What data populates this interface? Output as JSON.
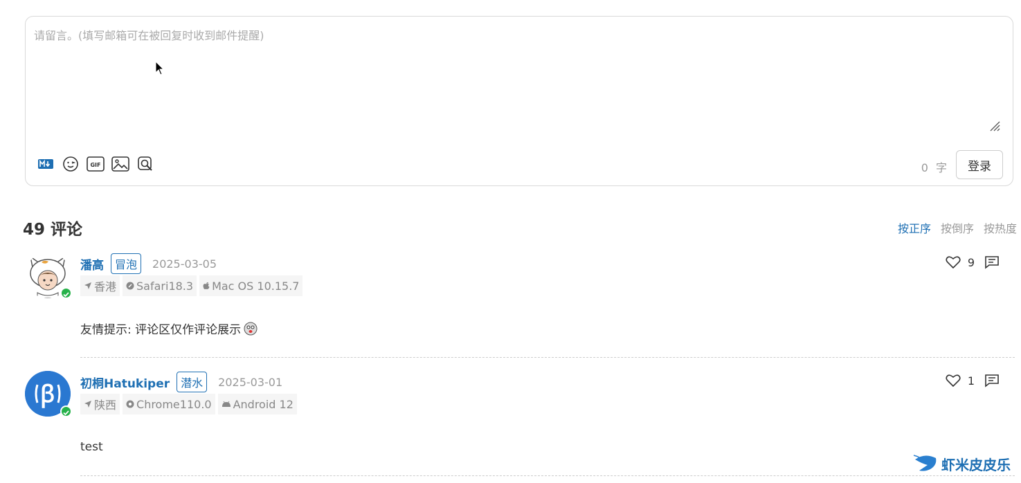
{
  "editor": {
    "placeholder": "请留言。(填写邮箱可在被回复时收到邮件提醒)",
    "tools": [
      "markdown-icon",
      "emoji-icon",
      "gif-icon",
      "image-icon",
      "preview-icon"
    ],
    "word_count": "0",
    "word_unit": "字",
    "login_label": "登录"
  },
  "comments_header": {
    "count_title": "49 评论",
    "sort_options": [
      "按正序",
      "按倒序",
      "按热度"
    ],
    "active_sort": "按正序"
  },
  "comments": [
    {
      "nick": "潘高",
      "badge": "冒泡",
      "date": "2025-03-05",
      "location": "香港",
      "browser": "Safari18.3",
      "os": "Mac OS 10.15.7",
      "content": "友情提示: 评论区仅作评论展示",
      "likes": "9"
    },
    {
      "nick": "初桐Hatukiper",
      "badge": "潜水",
      "date": "2025-03-01",
      "location": "陕西",
      "browser": "Chrome110.0",
      "os": "Android 12",
      "content": "test",
      "likes": "1"
    }
  ],
  "watermark": {
    "text": "虾米皮皮乐"
  },
  "colors": {
    "accent": "#1e6fb3",
    "verified": "#27b24a",
    "muted": "#999999"
  }
}
